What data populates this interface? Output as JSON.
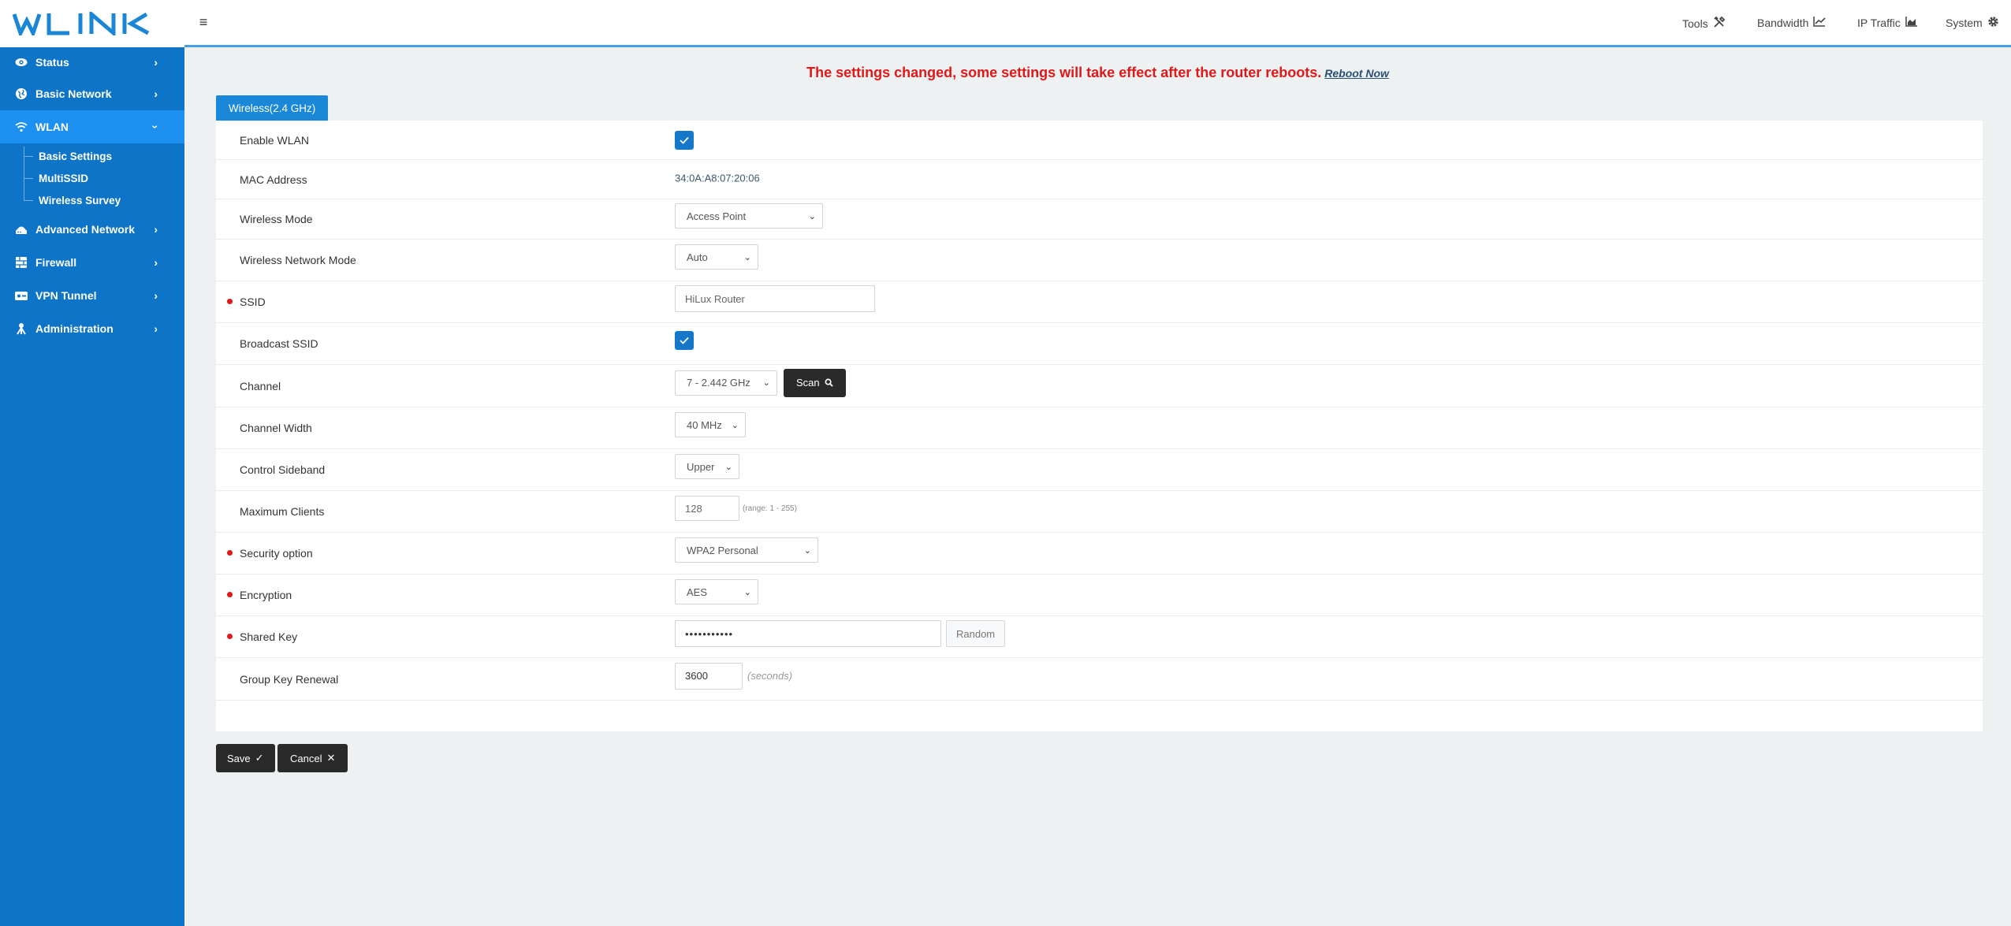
{
  "brand": {
    "logo_text": "WLINK",
    "color": "#1a86d6"
  },
  "colors": {
    "sidebar": "#0d74c8",
    "active": "#1e90f0",
    "alert": "#e01818",
    "tab": "#1a87d9"
  },
  "sidebar": {
    "items": [
      {
        "label": "Status",
        "icon": "eye-icon"
      },
      {
        "label": "Basic Network",
        "icon": "globe-icon"
      },
      {
        "label": "WLAN",
        "icon": "wifi-icon",
        "active": true,
        "sub": [
          {
            "label": "Basic Settings"
          },
          {
            "label": "MultiSSID"
          },
          {
            "label": "Wireless Survey"
          }
        ]
      },
      {
        "label": "Advanced Network",
        "icon": "router-icon"
      },
      {
        "label": "Firewall",
        "icon": "firewall-icon"
      },
      {
        "label": "VPN Tunnel",
        "icon": "vpn-icon"
      },
      {
        "label": "Administration",
        "icon": "admin-icon"
      }
    ]
  },
  "topbar": {
    "links": [
      {
        "label": "Tools",
        "icon": "tools-icon"
      },
      {
        "label": "Bandwidth",
        "icon": "chart-line-icon"
      },
      {
        "label": "IP Traffic",
        "icon": "chart-area-icon"
      },
      {
        "label": "System",
        "icon": "gear-icon"
      }
    ]
  },
  "notice": {
    "text": "The settings changed, some settings will take effect after the router reboots.",
    "link": "Reboot Now"
  },
  "tab": {
    "label": "Wireless(2.4 GHz)"
  },
  "form": {
    "enable_wlan": {
      "label": "Enable WLAN",
      "checked": true
    },
    "mac": {
      "label": "MAC Address",
      "value": "34:0A:A8:07:20:06"
    },
    "wireless_mode": {
      "label": "Wireless Mode",
      "value": "Access Point"
    },
    "network_mode": {
      "label": "Wireless Network Mode",
      "value": "Auto"
    },
    "ssid": {
      "label": "SSID",
      "value": "HiLux Router",
      "required": true
    },
    "broadcast": {
      "label": "Broadcast SSID",
      "checked": true
    },
    "channel": {
      "label": "Channel",
      "value": "7 - 2.442 GHz",
      "scan": "Scan"
    },
    "channel_width": {
      "label": "Channel Width",
      "value": "40 MHz"
    },
    "sideband": {
      "label": "Control Sideband",
      "value": "Upper"
    },
    "max_clients": {
      "label": "Maximum Clients",
      "value": "128",
      "hint": "(range: 1 - 255)"
    },
    "security": {
      "label": "Security option",
      "value": "WPA2 Personal",
      "required": true
    },
    "encryption": {
      "label": "Encryption",
      "value": "AES",
      "required": true
    },
    "shared_key": {
      "label": "Shared Key",
      "value": "•••••••••••",
      "random": "Random",
      "required": true
    },
    "group_key": {
      "label": "Group Key Renewal",
      "value": "3600",
      "hint": "(seconds)"
    }
  },
  "actions": {
    "save": "Save",
    "cancel": "Cancel"
  }
}
